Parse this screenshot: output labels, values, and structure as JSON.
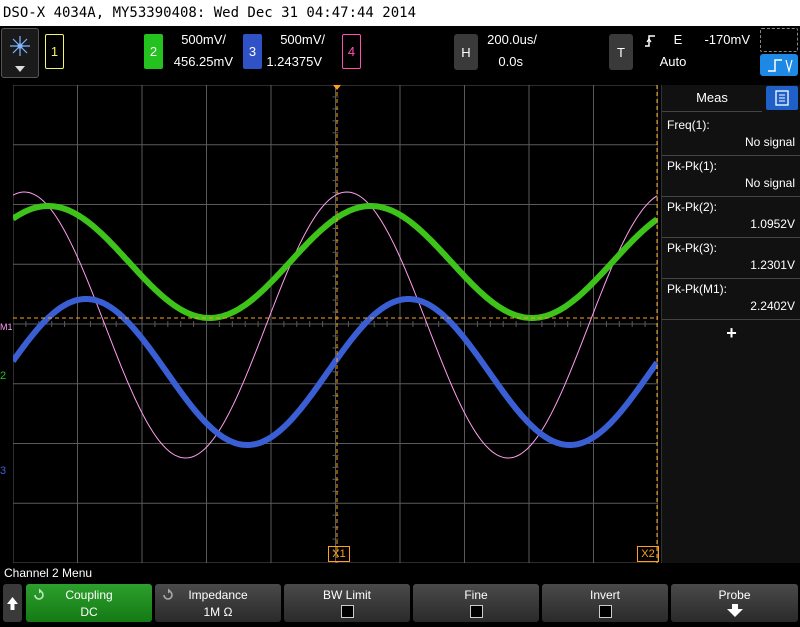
{
  "title_bar": "DSO-X 4034A, MY53390408: Wed Dec 31 04:47:44 2014",
  "channels": [
    {
      "num": "1",
      "scale": "",
      "offset": "",
      "color": "#f5f56a"
    },
    {
      "num": "2",
      "scale": "500mV/",
      "offset": "456.25mV",
      "color": "#23c21f"
    },
    {
      "num": "3",
      "scale": "500mV/",
      "offset": "1.24375V",
      "color": "#3a5fd4"
    },
    {
      "num": "4",
      "scale": "",
      "offset": "",
      "color": "#ff4fb5"
    }
  ],
  "horizontal": {
    "key": "H",
    "time_div": "200.0us/",
    "delay": "0.0s"
  },
  "trigger": {
    "key": "T",
    "edge_icon": "rising-edge-icon",
    "source": "E",
    "level": "-170mV",
    "mode": "Auto"
  },
  "markers": {
    "m1": "M1",
    "ch2": "2",
    "ch3": "3",
    "x1": "X1",
    "x2": "X2"
  },
  "meas": {
    "tab_label": "Meas",
    "items": [
      {
        "label": "Freq(1):",
        "value": "No signal"
      },
      {
        "label": "Pk-Pk(1):",
        "value": "No signal"
      },
      {
        "label": "Pk-Pk(2):",
        "value": "1.0952V"
      },
      {
        "label": "Pk-Pk(3):",
        "value": "1.2301V"
      },
      {
        "label": "Pk-Pk(M1):",
        "value": "2.2402V"
      }
    ],
    "add_symbol": "+"
  },
  "menu": {
    "title": "Channel 2 Menu",
    "softkeys": [
      {
        "label": "Coupling",
        "value": "DC"
      },
      {
        "label": "Impedance",
        "value": "1M Ω"
      },
      {
        "label": "BW Limit",
        "value": ""
      },
      {
        "label": "Fine",
        "value": ""
      },
      {
        "label": "Invert",
        "value": ""
      },
      {
        "label": "Probe",
        "value": ""
      }
    ]
  },
  "colors": {
    "grid": "#5a5a5a",
    "cursor": "#ff9f1c",
    "math": "#ff9ef0",
    "selected_key": "#1c8c1c"
  }
}
